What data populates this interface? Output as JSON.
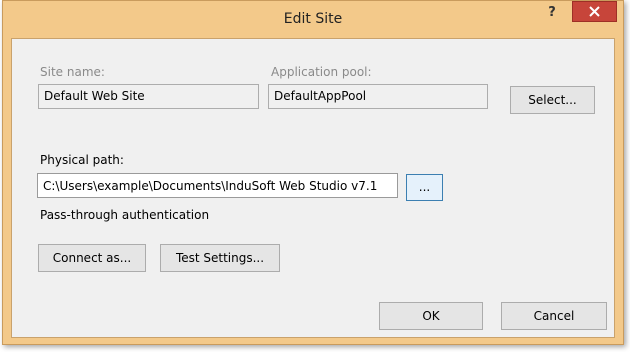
{
  "window": {
    "title": "Edit Site",
    "help_label": "?"
  },
  "site_name": {
    "label": "Site name:",
    "value": "Default Web Site"
  },
  "app_pool": {
    "label": "Application pool:",
    "value": "DefaultAppPool"
  },
  "buttons": {
    "select": "Select...",
    "browse": "...",
    "connect_as": "Connect as...",
    "test_settings": "Test Settings...",
    "ok": "OK",
    "cancel": "Cancel"
  },
  "physical_path": {
    "label": "Physical path:",
    "value": "C:\\Users\\example\\Documents\\InduSoft Web Studio v7.1"
  },
  "auth_text": "Pass-through authentication",
  "colors": {
    "title_bar": "#f3c98a",
    "close_button": "#c7453a",
    "dialog_background": "#f0f0f0"
  }
}
